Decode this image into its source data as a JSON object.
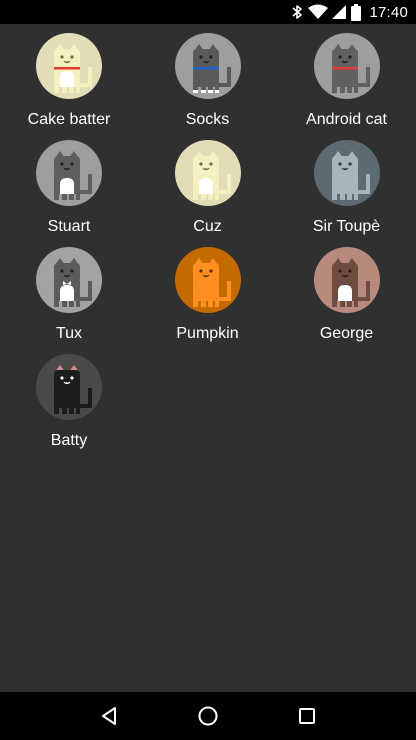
{
  "status_bar": {
    "time": "17:40",
    "icons": [
      "bluetooth-icon",
      "wifi-icon",
      "signal-icon",
      "battery-icon"
    ]
  },
  "cats": [
    {
      "name": "Cake batter",
      "body": "#f6efc0",
      "bg": "#e2ddb7",
      "collar": "#e53935",
      "belly": "#ffffff",
      "dark": "#6f6a4c"
    },
    {
      "name": "Socks",
      "body": "#5a5a5a",
      "bg": "#9e9e9e",
      "collar": "#1e63d0",
      "belly": "#5a5a5a",
      "dark": "#202020",
      "socks": "#ffffff"
    },
    {
      "name": "Android cat",
      "body": "#616161",
      "bg": "#9e9e9e",
      "collar": "#e53935",
      "belly": "#616161",
      "dark": "#202020"
    },
    {
      "name": "Stuart",
      "body": "#5f5f5f",
      "bg": "#9e9e9e",
      "collar": "",
      "belly": "#ffffff",
      "dark": "#202020"
    },
    {
      "name": "Cuz",
      "body": "#f6efc0",
      "bg": "#e2ddb7",
      "collar": "",
      "belly": "#ffffff",
      "dark": "#6f6a4c"
    },
    {
      "name": "Sir Toupè",
      "body": "#a6b6bd",
      "bg": "#5c6b72",
      "collar": "",
      "belly": "#a6b6bd",
      "dark": "#2b3539"
    },
    {
      "name": "Tux",
      "body": "#5b5b5b",
      "bg": "#a3a3a3",
      "collar": "",
      "belly": "#ffffff",
      "dark": "#202020",
      "tie": "#ffffff"
    },
    {
      "name": "Pumpkin",
      "body": "#ff8f1f",
      "bg": "#c46a00",
      "collar": "",
      "belly": "#ff8f1f",
      "dark": "#5a2c00"
    },
    {
      "name": "George",
      "body": "#6d4c41",
      "bg": "#b88a7e",
      "collar": "",
      "belly": "#ffffff",
      "dark": "#2c1b15"
    },
    {
      "name": "Batty",
      "body": "#1c1c1c",
      "bg": "#4a4a4a",
      "collar": "",
      "belly": "#1c1c1c",
      "dark": "#ffffff",
      "ears": "#d98b8b"
    }
  ],
  "nav": {
    "back": "back-icon",
    "home": "home-icon",
    "recents": "recents-icon"
  }
}
